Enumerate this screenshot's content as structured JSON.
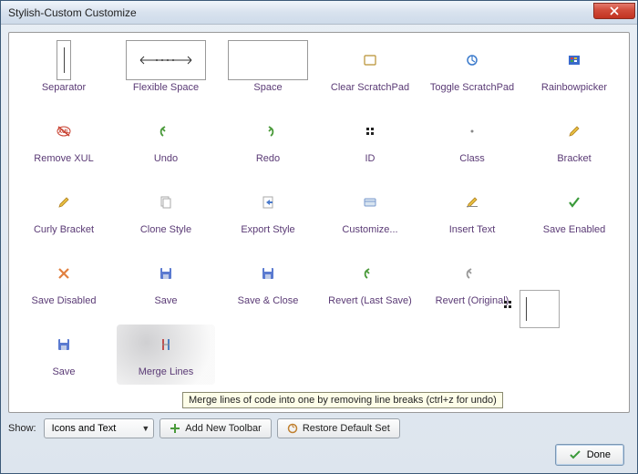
{
  "titlebar": {
    "title": "Stylish-Custom Customize"
  },
  "palette": {
    "items": [
      {
        "label": "Separator",
        "icon": "separator",
        "outlined": "narrow"
      },
      {
        "label": "Flexible Space",
        "icon": "flexspace",
        "outlined": "wide"
      },
      {
        "label": "Space",
        "icon": "blank",
        "outlined": "wide"
      },
      {
        "label": "Clear ScratchPad",
        "icon": "clear-pad"
      },
      {
        "label": "Toggle ScratchPad",
        "icon": "toggle-pad"
      },
      {
        "label": "Rainbowpicker",
        "icon": "rainbow"
      },
      {
        "label": "Remove XUL",
        "icon": "remove-xul"
      },
      {
        "label": "Undo",
        "icon": "undo"
      },
      {
        "label": "Redo",
        "icon": "redo"
      },
      {
        "label": "ID",
        "icon": "id"
      },
      {
        "label": "Class",
        "icon": "class"
      },
      {
        "label": "Bracket",
        "icon": "pencil"
      },
      {
        "label": "Curly Bracket",
        "icon": "pencil"
      },
      {
        "label": "Clone Style",
        "icon": "clone"
      },
      {
        "label": "Export Style",
        "icon": "export"
      },
      {
        "label": "Customize...",
        "icon": "customize"
      },
      {
        "label": "Insert Text",
        "icon": "insert-text"
      },
      {
        "label": "Save Enabled",
        "icon": "check-green"
      },
      {
        "label": "Save Disabled",
        "icon": "x-orange"
      },
      {
        "label": "Save",
        "icon": "floppy"
      },
      {
        "label": "Save & Close",
        "icon": "floppy"
      },
      {
        "label": "Revert (Last Save)",
        "icon": "undo"
      },
      {
        "label": "Revert (Original)",
        "icon": "undo-gray"
      },
      {
        "label": "",
        "icon": "blank"
      },
      {
        "label": "Save",
        "icon": "floppy"
      },
      {
        "label": "Merge Lines",
        "icon": "merge",
        "hovered": true
      }
    ]
  },
  "tooltip": "Merge lines of code into one by removing line breaks (ctrl+z for undo)",
  "bottom": {
    "show_label": "Show:",
    "show_value": "Icons and Text",
    "add_toolbar": "Add New Toolbar",
    "restore": "Restore Default Set"
  },
  "footer": {
    "done": "Done"
  }
}
